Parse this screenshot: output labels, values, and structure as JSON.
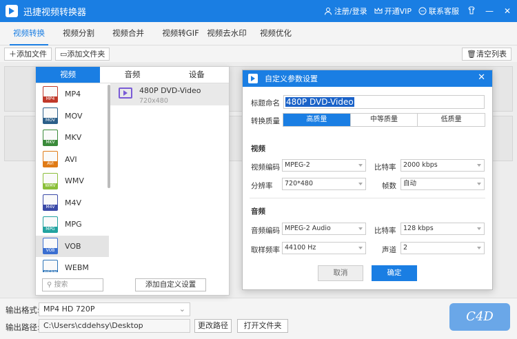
{
  "app": {
    "title": "迅捷视频转换器",
    "register": "注册/登录",
    "vip": "开通VIP",
    "service": "联系客服"
  },
  "main_tabs": [
    "视频转换",
    "视频分割",
    "视频合并",
    "视频转GIF",
    "视频去水印",
    "视频优化"
  ],
  "toolbar": {
    "add_file": "添加文件",
    "add_folder": "添加文件夹",
    "clear_list": "清空列表"
  },
  "format_panel": {
    "tabs": [
      "视频",
      "音频",
      "设备"
    ],
    "formats": [
      {
        "name": "MP4",
        "color": "#c0392b"
      },
      {
        "name": "MOV",
        "color": "#2c5f8a"
      },
      {
        "name": "MKV",
        "color": "#3a8a3a"
      },
      {
        "name": "AVI",
        "color": "#e07b16"
      },
      {
        "name": "WMV",
        "color": "#8bbf3a"
      },
      {
        "name": "M4V",
        "color": "#3b4aa8"
      },
      {
        "name": "MPG",
        "color": "#21a3a0"
      },
      {
        "name": "VOB",
        "color": "#3b6fd1"
      },
      {
        "name": "WEBM",
        "color": "#2b73b8"
      }
    ],
    "selected_format": "VOB",
    "preset": {
      "name": "480P DVD-Video",
      "resolution": "720x480"
    },
    "search_placeholder": "搜索",
    "add_custom": "添加自定义设置"
  },
  "dialog": {
    "title": "自定义参数设置",
    "name_label": "标题命名",
    "name_value": "480P DVD-Video",
    "quality_label": "转换质量",
    "quality_options": [
      "高质量",
      "中等质量",
      "低质量"
    ],
    "video_section": "视频",
    "video_codec_label": "视频编码",
    "video_codec": "MPEG-2",
    "video_bitrate_label": "比特率",
    "video_bitrate": "2000 kbps",
    "resolution_label": "分辨率",
    "resolution": "720*480",
    "fps_label": "帧数",
    "fps": "自动",
    "audio_section": "音频",
    "audio_codec_label": "音频编码",
    "audio_codec": "MPEG-2 Audio",
    "audio_bitrate_label": "比特率",
    "audio_bitrate": "128 kbps",
    "sample_rate_label": "取样频率",
    "sample_rate": "44100 Hz",
    "channels_label": "声道",
    "channels": "2",
    "cancel": "取消",
    "ok": "确定"
  },
  "footer": {
    "output_format_label": "输出格式:",
    "output_format": "MP4  HD 720P",
    "output_path_label": "输出路径:",
    "output_path": "C:\\Users\\cddehsy\\Desktop",
    "change_path": "更改路径",
    "open_folder": "打开文件夹"
  },
  "colors": {
    "accent": "#1a7ee3"
  }
}
